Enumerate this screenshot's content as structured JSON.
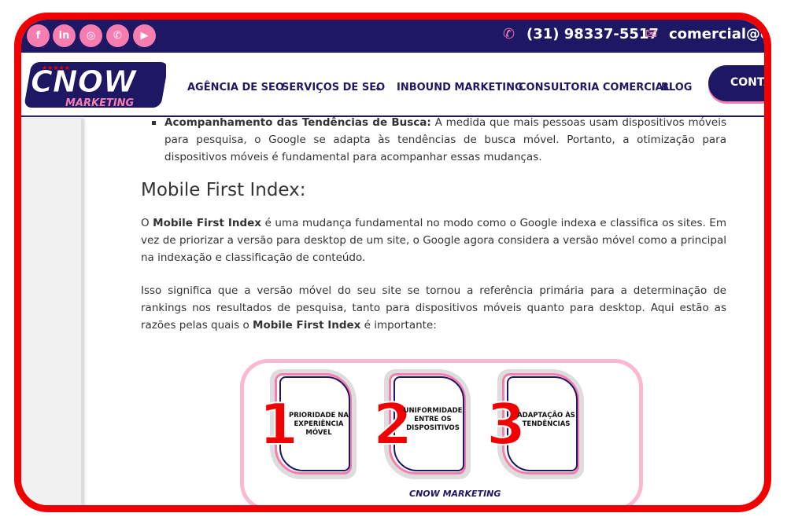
{
  "topbar": {
    "social": [
      {
        "icon": "facebook-icon",
        "glyph": "f"
      },
      {
        "icon": "linkedin-icon",
        "glyph": "in"
      },
      {
        "icon": "instagram-icon",
        "glyph": "◎"
      },
      {
        "icon": "whatsapp-icon",
        "glyph": "✆"
      },
      {
        "icon": "youtube-icon",
        "glyph": "▶"
      }
    ],
    "phone": "(31) 98337-5517",
    "email": "comercial@cr"
  },
  "header": {
    "logo_text": "CNOW MARKETING",
    "nav": [
      "AGÊNCIA DE SEO",
      "SERVIÇOS DE SEO",
      "INBOUND MARKETING",
      "CONSULTORIA COMERCIAL",
      "BLOG"
    ],
    "cta": "CONTA"
  },
  "article": {
    "bullet_bold": "Acompanhamento das Tendências de Busca:",
    "bullet_text": " À medida que mais pessoas usam dispositivos móveis para pesquisa, o Google se adapta às tendências de busca móvel. Portanto, a otimização para dispositivos móveis é fundamental para acompanhar essas mudanças.",
    "heading": "Mobile First Index:",
    "p1_a": "O ",
    "p1_bold": "Mobile First Index",
    "p1_b": " é uma mudança fundamental no modo como o Google indexa e classifica os sites. Em vez de priorizar a versão para desktop de um site, o Google agora considera a versão móvel como a principal na indexação e classificação de conteúdo.",
    "p2_a": "Isso significa que a versão móvel do seu site se tornou a referência primária para a determinação de rankings nos resultados de pesquisa, tanto para dispositivos móveis quanto para desktop. Aqui estão as razões pelas quais o ",
    "p2_bold": "Mobile First Index",
    "p2_b": " é importante:"
  },
  "infographic": {
    "cards": [
      {
        "num": "1",
        "text": "PRIORIDADE NA EXPERIÊNCIA MÓVEL"
      },
      {
        "num": "2",
        "text": "UNIFORMIDADE ENTRE OS DISPOSITIVOS"
      },
      {
        "num": "3",
        "text": "ADAPTAÇÃO ÀS TENDÊNCIAS"
      }
    ],
    "logo_text": "CNOW MARKETING"
  },
  "colors": {
    "navy": "#1e1764",
    "pink": "#f57db0",
    "frame_red": "#f20000"
  }
}
